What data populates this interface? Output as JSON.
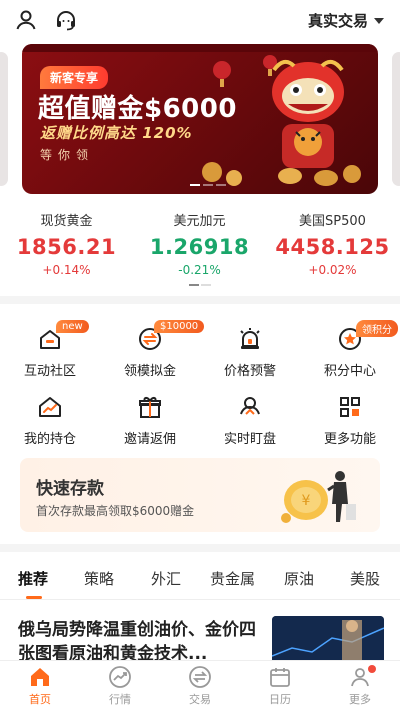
{
  "header": {
    "trade_mode": "真实交易",
    "icons": [
      "user-icon",
      "headset-icon",
      "caret-down-icon"
    ]
  },
  "banner": {
    "tag": "新客专享",
    "headline": "超值赠金$6000",
    "subline": "返赠比例高达 120%",
    "cta": "等你领"
  },
  "quotes": [
    {
      "name": "现货黄金",
      "price": "1856.21",
      "change": "+0.14%",
      "direction": "up"
    },
    {
      "name": "美元加元",
      "price": "1.26918",
      "change": "-0.21%",
      "direction": "down"
    },
    {
      "name": "美国SP500",
      "price": "4458.125",
      "change": "+0.02%",
      "direction": "up"
    }
  ],
  "features": [
    {
      "label": "互动社区",
      "badge": "new",
      "icon": "chat-house-icon"
    },
    {
      "label": "领模拟金",
      "badge": "$10000",
      "icon": "exchange-icon"
    },
    {
      "label": "价格预警",
      "badge": "",
      "icon": "alarm-icon"
    },
    {
      "label": "积分中心",
      "badge": "领积分",
      "icon": "star-badge-icon"
    },
    {
      "label": "我的持仓",
      "badge": "",
      "icon": "holdings-chart-icon"
    },
    {
      "label": "邀请返佣",
      "badge": "",
      "icon": "gift-icon"
    },
    {
      "label": "实时盯盘",
      "badge": "",
      "icon": "watch-person-icon"
    },
    {
      "label": "更多功能",
      "badge": "",
      "icon": "grid-icon"
    }
  ],
  "deposit": {
    "title": "快速存款",
    "subtitle": "首次存款最高领取$6000赠金"
  },
  "tabs": [
    "推荐",
    "策略",
    "外汇",
    "贵金属",
    "原油",
    "美股"
  ],
  "active_tab": "推荐",
  "news": {
    "title": "俄乌局势降温重创油价、金价四张图看原油和黄金技术..."
  },
  "bottom_nav": [
    {
      "label": "首页",
      "icon": "home-icon",
      "active": true
    },
    {
      "label": "行情",
      "icon": "trend-icon",
      "active": false
    },
    {
      "label": "交易",
      "icon": "swap-icon",
      "active": false
    },
    {
      "label": "日历",
      "icon": "calendar-icon",
      "active": false
    },
    {
      "label": "更多",
      "icon": "person-more-icon",
      "active": false
    }
  ],
  "colors": {
    "accent": "#ff6a1a",
    "up": "#e43a3a",
    "down": "#1aa66a",
    "banner_bg": "#8c0e12"
  }
}
